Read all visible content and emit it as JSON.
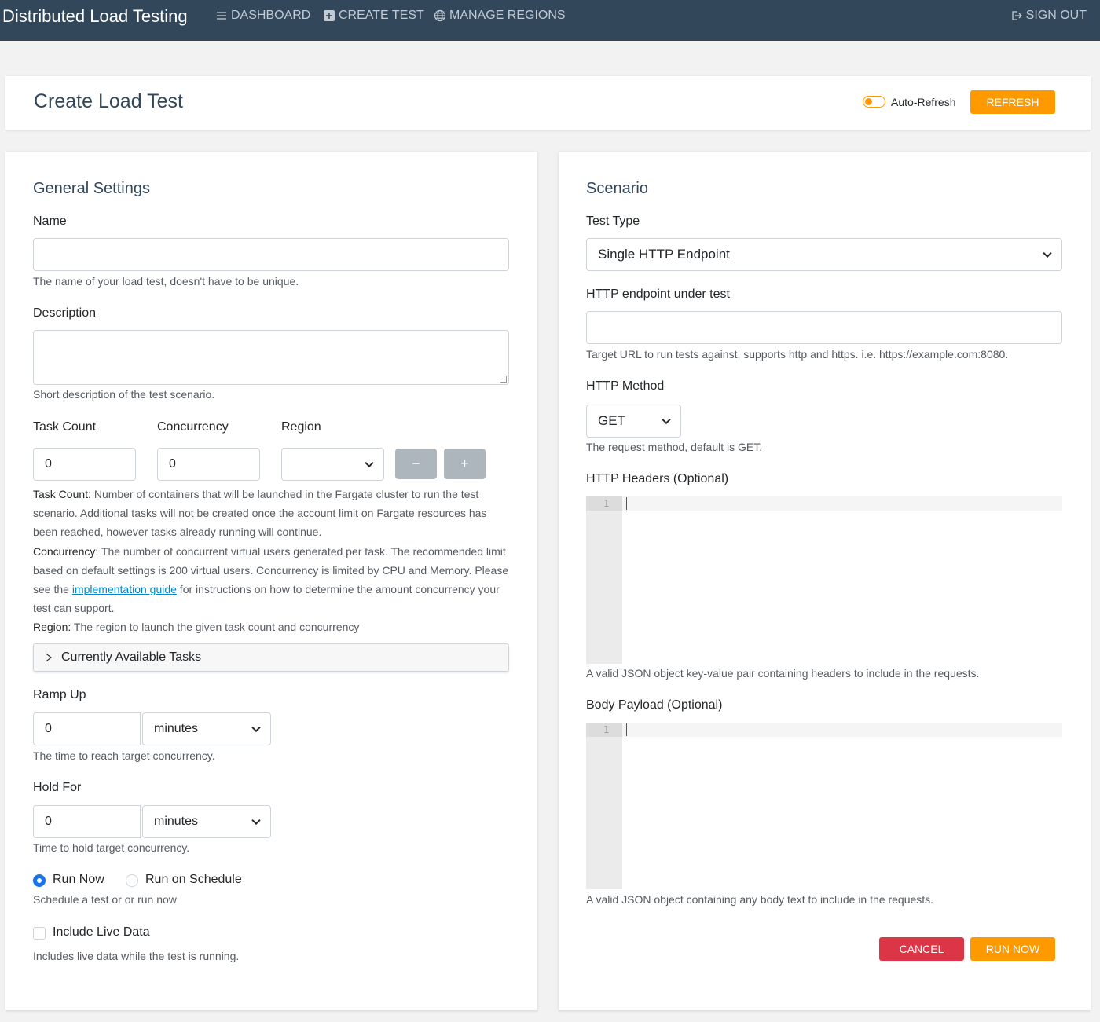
{
  "navbar": {
    "brand": "Distributed Load Testing",
    "dashboard": "DASHBOARD",
    "create_test": "CREATE TEST",
    "manage_regions": "MANAGE REGIONS",
    "sign_out": "SIGN OUT"
  },
  "header": {
    "title": "Create Load Test",
    "auto_refresh_label": "Auto-Refresh",
    "auto_refresh_on": false,
    "refresh_button": "REFRESH"
  },
  "general": {
    "title": "General Settings",
    "name_label": "Name",
    "name_value": "",
    "name_help": "The name of your load test, doesn't have to be unique.",
    "description_label": "Description",
    "description_value": "",
    "description_help": "Short description of the test scenario.",
    "task_count_label": "Task Count",
    "task_count_value": "0",
    "concurrency_label": "Concurrency",
    "concurrency_value": "0",
    "region_label": "Region",
    "region_value": "",
    "remove_button": "−",
    "add_button": "+",
    "help": {
      "task_count_key": "Task Count:",
      "task_count_text": " Number of containers that will be launched in the Fargate cluster to run the test scenario. Additional tasks will not be created once the account limit on Fargate resources has been reached, however tasks already running will continue.",
      "concurrency_key": "Concurrency:",
      "concurrency_text_1": " The number of concurrent virtual users generated per task. The recommended limit based on default settings is 200 virtual users. Concurrency is limited by CPU and Memory. Please see the ",
      "implementation_guide_link": "implementation guide",
      "concurrency_text_2": " for instructions on how to determine the amount concurrency your test can support.",
      "region_key": "Region:",
      "region_text": " The region to launch the given task count and concurrency"
    },
    "available_tasks_label": "Currently Available Tasks",
    "ramp_up_label": "Ramp Up",
    "ramp_up_value": "0",
    "ramp_up_unit": "minutes",
    "ramp_up_help": "The time to reach target concurrency.",
    "hold_for_label": "Hold For",
    "hold_for_value": "0",
    "hold_for_unit": "minutes",
    "hold_for_help": "Time to hold target concurrency.",
    "run_now_label": "Run Now",
    "run_schedule_label": "Run on Schedule",
    "schedule_help": "Schedule a test or or run now",
    "live_data_label": "Include Live Data",
    "live_data_help": "Includes live data while the test is running."
  },
  "scenario": {
    "title": "Scenario",
    "test_type_label": "Test Type",
    "test_type_value": "Single HTTP Endpoint",
    "endpoint_label": "HTTP endpoint under test",
    "endpoint_value": "",
    "endpoint_help": "Target URL to run tests against, supports http and https. i.e. https://example.com:8080.",
    "method_label": "HTTP Method",
    "method_value": "GET",
    "method_help": "The request method, default is GET.",
    "headers_label": "HTTP Headers (Optional)",
    "headers_line": "1",
    "headers_help": "A valid JSON object key-value pair containing headers to include in the requests.",
    "body_label": "Body Payload (Optional)",
    "body_line": "1",
    "body_help": "A valid JSON object containing any body text to include in the requests.",
    "cancel_button": "CANCEL",
    "run_button": "RUN NOW"
  },
  "colors": {
    "navbar": "#33475b",
    "accent": "#ff9900",
    "danger": "#dc3545",
    "link": "#0088cc"
  }
}
